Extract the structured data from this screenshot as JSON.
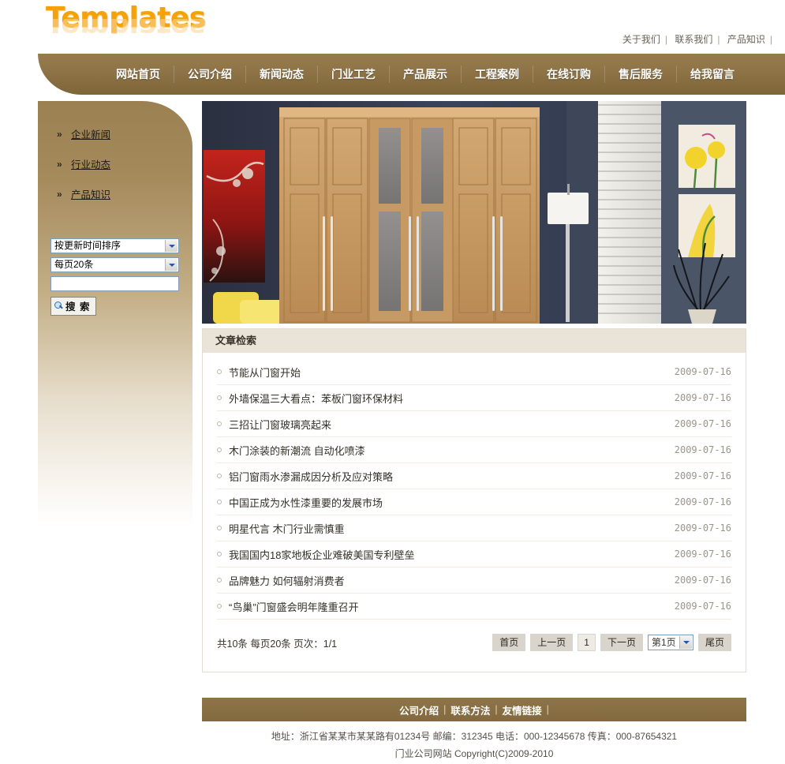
{
  "site": {
    "logo_text": "Templates"
  },
  "toplinks": [
    {
      "label": "关于我们"
    },
    {
      "label": "联系我们"
    },
    {
      "label": "产品知识"
    }
  ],
  "nav": {
    "items": [
      {
        "label": "网站首页"
      },
      {
        "label": "公司介绍"
      },
      {
        "label": "新闻动态"
      },
      {
        "label": "门业工艺"
      },
      {
        "label": "产品展示"
      },
      {
        "label": "工程案例"
      },
      {
        "label": "在线订购"
      },
      {
        "label": "售后服务"
      },
      {
        "label": "给我留言"
      }
    ]
  },
  "sidebar": {
    "arrow_glyph": "»",
    "links": [
      {
        "label": "企业新闻"
      },
      {
        "label": "行业动态"
      },
      {
        "label": "产品知识"
      }
    ],
    "sort_select": {
      "value": "按更新时间排序"
    },
    "perpage_select": {
      "value": "每页20条"
    },
    "keyword_input": {
      "value": "",
      "placeholder": ""
    },
    "search_button": {
      "label": "搜 索",
      "icon": "magnifier-icon"
    }
  },
  "banner": {
    "alt": "木门衣柜室内展示图"
  },
  "panel": {
    "title": "文章检索",
    "articles": [
      {
        "title": "节能从门窗开始",
        "date": "2009-07-16"
      },
      {
        "title": "外墙保温三大看点：苯板门窗环保材料",
        "date": "2009-07-16"
      },
      {
        "title": "三招让门窗玻璃亮起来",
        "date": "2009-07-16"
      },
      {
        "title": "木门涂装的新潮流 自动化喷漆",
        "date": "2009-07-16"
      },
      {
        "title": "铝门窗雨水渗漏成因分析及应对策略",
        "date": "2009-07-16"
      },
      {
        "title": "中国正成为水性漆重要的发展市场",
        "date": "2009-07-16"
      },
      {
        "title": "明星代言 木门行业需慎重",
        "date": "2009-07-16"
      },
      {
        "title": "我国国内18家地板企业难破美国专利壁垒",
        "date": "2009-07-16"
      },
      {
        "title": "品牌魅力 如何辐射消费者",
        "date": "2009-07-16"
      },
      {
        "title": "“鸟巢”门窗盛会明年隆重召开",
        "date": "2009-07-16"
      }
    ]
  },
  "pager": {
    "summary": "共10条 每页20条 页次：1/1",
    "first": "首页",
    "prev": "上一页",
    "current_num": "1",
    "next": "下一页",
    "page_select": {
      "value": "第1页"
    },
    "last": "尾页"
  },
  "footer": {
    "links": [
      {
        "label": "公司介绍"
      },
      {
        "label": "联系方法"
      },
      {
        "label": "友情链接"
      }
    ],
    "address_line": "地址：浙江省某某市某某路有01234号 邮编：312345 电话：000-12345678 传真：000-87654321",
    "copyright_line": "门业公司网站 Copyright(C)2009-2010"
  },
  "colors": {
    "brand_brown": "#8d7346",
    "logo_orange": "#f5a209",
    "panel_head": "#e9e3d8"
  }
}
